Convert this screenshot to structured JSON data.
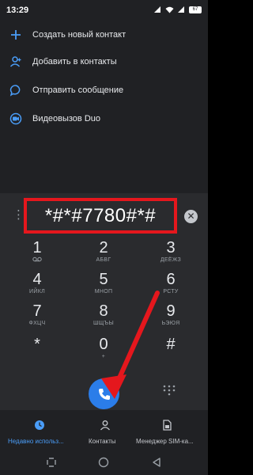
{
  "status_bar": {
    "time": "13:29",
    "battery": "67"
  },
  "actions": [
    {
      "label": "Создать новый контакт",
      "icon": "plus-icon"
    },
    {
      "label": "Добавить в контакты",
      "icon": "add-person-icon"
    },
    {
      "label": "Отправить сообщение",
      "icon": "message-icon"
    },
    {
      "label": "Видеовызов Duo",
      "icon": "duo-video-icon"
    }
  ],
  "dialer": {
    "number": "*#*#7780#*#",
    "keys": [
      {
        "digit": "1",
        "letters": ""
      },
      {
        "digit": "2",
        "letters": "АБВГ"
      },
      {
        "digit": "3",
        "letters": "ДЕЁЖЗ"
      },
      {
        "digit": "4",
        "letters": "ИЙКЛ"
      },
      {
        "digit": "5",
        "letters": "МНОП"
      },
      {
        "digit": "6",
        "letters": "РСТУ"
      },
      {
        "digit": "7",
        "letters": "ФХЦЧ"
      },
      {
        "digit": "8",
        "letters": "ШЩЪЫ"
      },
      {
        "digit": "9",
        "letters": "ЬЭЮЯ"
      },
      {
        "digit": "*",
        "letters": ""
      },
      {
        "digit": "0",
        "letters": "+"
      },
      {
        "digit": "#",
        "letters": ""
      }
    ]
  },
  "tabs": [
    {
      "label": "Недавно использ...",
      "icon": "clock-icon",
      "active": true
    },
    {
      "label": "Контакты",
      "icon": "person-icon",
      "active": false
    },
    {
      "label": "Менеджер SIM-ка...",
      "icon": "sim-card-icon",
      "active": false
    }
  ],
  "colors": {
    "accent": "#4a9df8",
    "call_button": "#2b7de9",
    "highlight_box": "#e5171d",
    "annotation_arrow": "#e5171d"
  }
}
